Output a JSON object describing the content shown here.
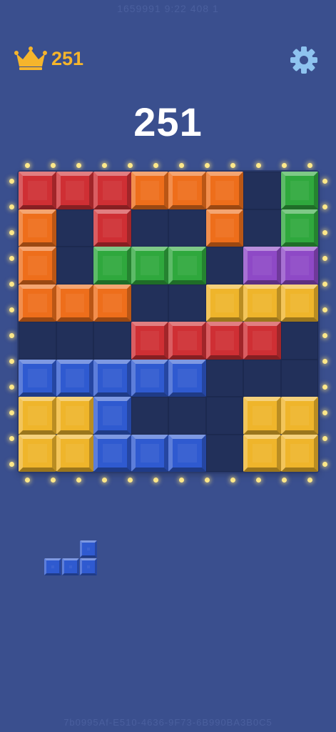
{
  "watermark": {
    "top": "1659991 9:22 408 1",
    "bottom": "7b0995Af-E510-4636-9F73-6B990BA3B0C5"
  },
  "header": {
    "best_score": "251",
    "crown_icon": "crown-icon",
    "settings_icon": "gear-icon"
  },
  "score": "251",
  "colors": {
    "background": "#3a4f8e",
    "board": "#22305a",
    "red": "#cf2f34",
    "orange": "#ee6e1b",
    "green": "#2fa83d",
    "purple": "#8e49c6",
    "yellow": "#efb52b",
    "blue": "#2f5ad0",
    "crown": "#f5b52c",
    "gear": "#8ec3ef"
  },
  "board": {
    "grid": [
      "RRROOO.G",
      "O.R..O.G",
      "O.GGG.PP",
      "OOO..YYY",
      "...RRRR.",
      "BBBBB...",
      "YYB...YY",
      "YYBBB.YY"
    ]
  },
  "pieces": [
    {
      "color": "B",
      "cells": [
        [
          0,
          2
        ],
        [
          1,
          0
        ],
        [
          1,
          1
        ],
        [
          1,
          2
        ]
      ]
    }
  ]
}
